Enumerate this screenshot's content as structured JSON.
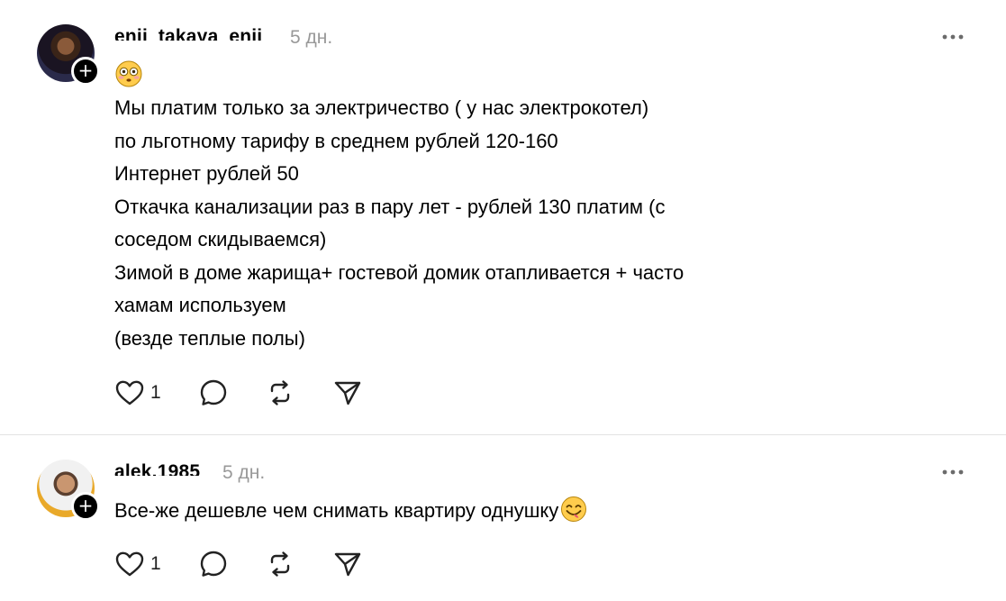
{
  "posts": [
    {
      "username": "enji_takaya_enji",
      "time": "5 дн.",
      "emoji": "flushed-face",
      "text": "Мы платим только за электричество ( у нас электрокотел)\nпо льготному тарифу в среднем рублей 120-160\nИнтернет рублей 50\nОткачка канализации раз в пару лет - рублей 130 платим (с\nсоседом скидываемся)\nЗимой в доме жарища+ гостевой домик отапливается + часто\nхамам используем\n(везде теплые полы)",
      "likes": "1",
      "follow_symbol": "+"
    },
    {
      "username": "alek.1985",
      "time": "5 дн.",
      "text": "Все-же дешевле чем снимать квартиру однушку",
      "trailing_emoji": "face-savoring-food",
      "likes": "1",
      "follow_symbol": "+"
    }
  ],
  "icons": {
    "more": "more-horizontal-icon",
    "like": "heart-icon",
    "reply": "comment-icon",
    "repost": "repost-icon",
    "share": "send-icon"
  },
  "colors": {
    "text": "#000000",
    "muted": "#999999",
    "divider": "#e3e3e3"
  }
}
